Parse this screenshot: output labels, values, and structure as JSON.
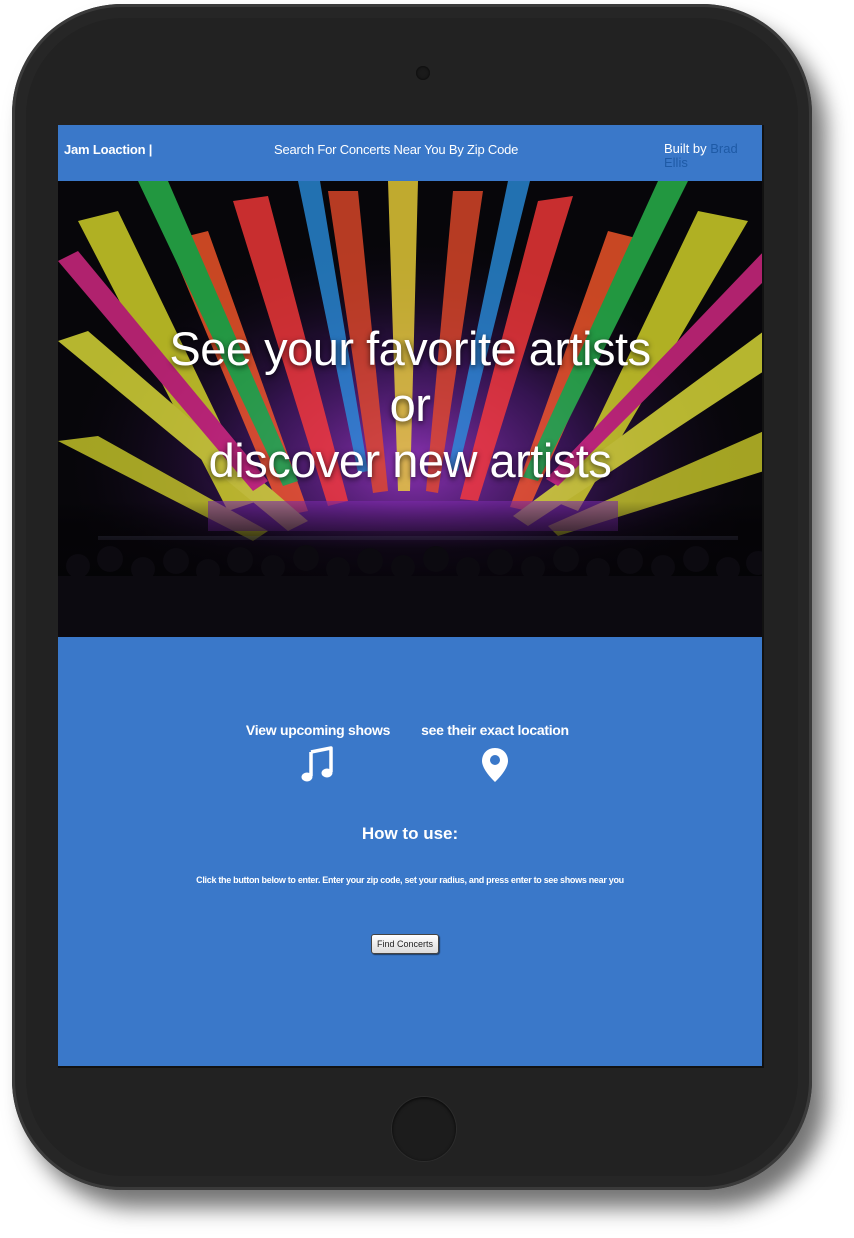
{
  "navbar": {
    "brand": "Jam Loaction |",
    "tagline": "Search For Concerts Near You By Zip Code",
    "credit_prefix": "Built by",
    "credit_author": "Brad Ellis"
  },
  "hero": {
    "line1": "See your favorite artists",
    "line2": "or",
    "line3": "discover new artists"
  },
  "features": [
    {
      "label": "View upcoming shows",
      "icon": "music-note-icon"
    },
    {
      "label": "see their exact location",
      "icon": "map-pin-icon"
    }
  ],
  "howto": {
    "title": "How to use:",
    "text": "Click the button below to enter. Enter your zip code, set your radius, and press enter to see shows near you"
  },
  "button": {
    "label": "Find Concerts"
  },
  "colors": {
    "accent": "#3a78c9",
    "device": "#262626"
  }
}
